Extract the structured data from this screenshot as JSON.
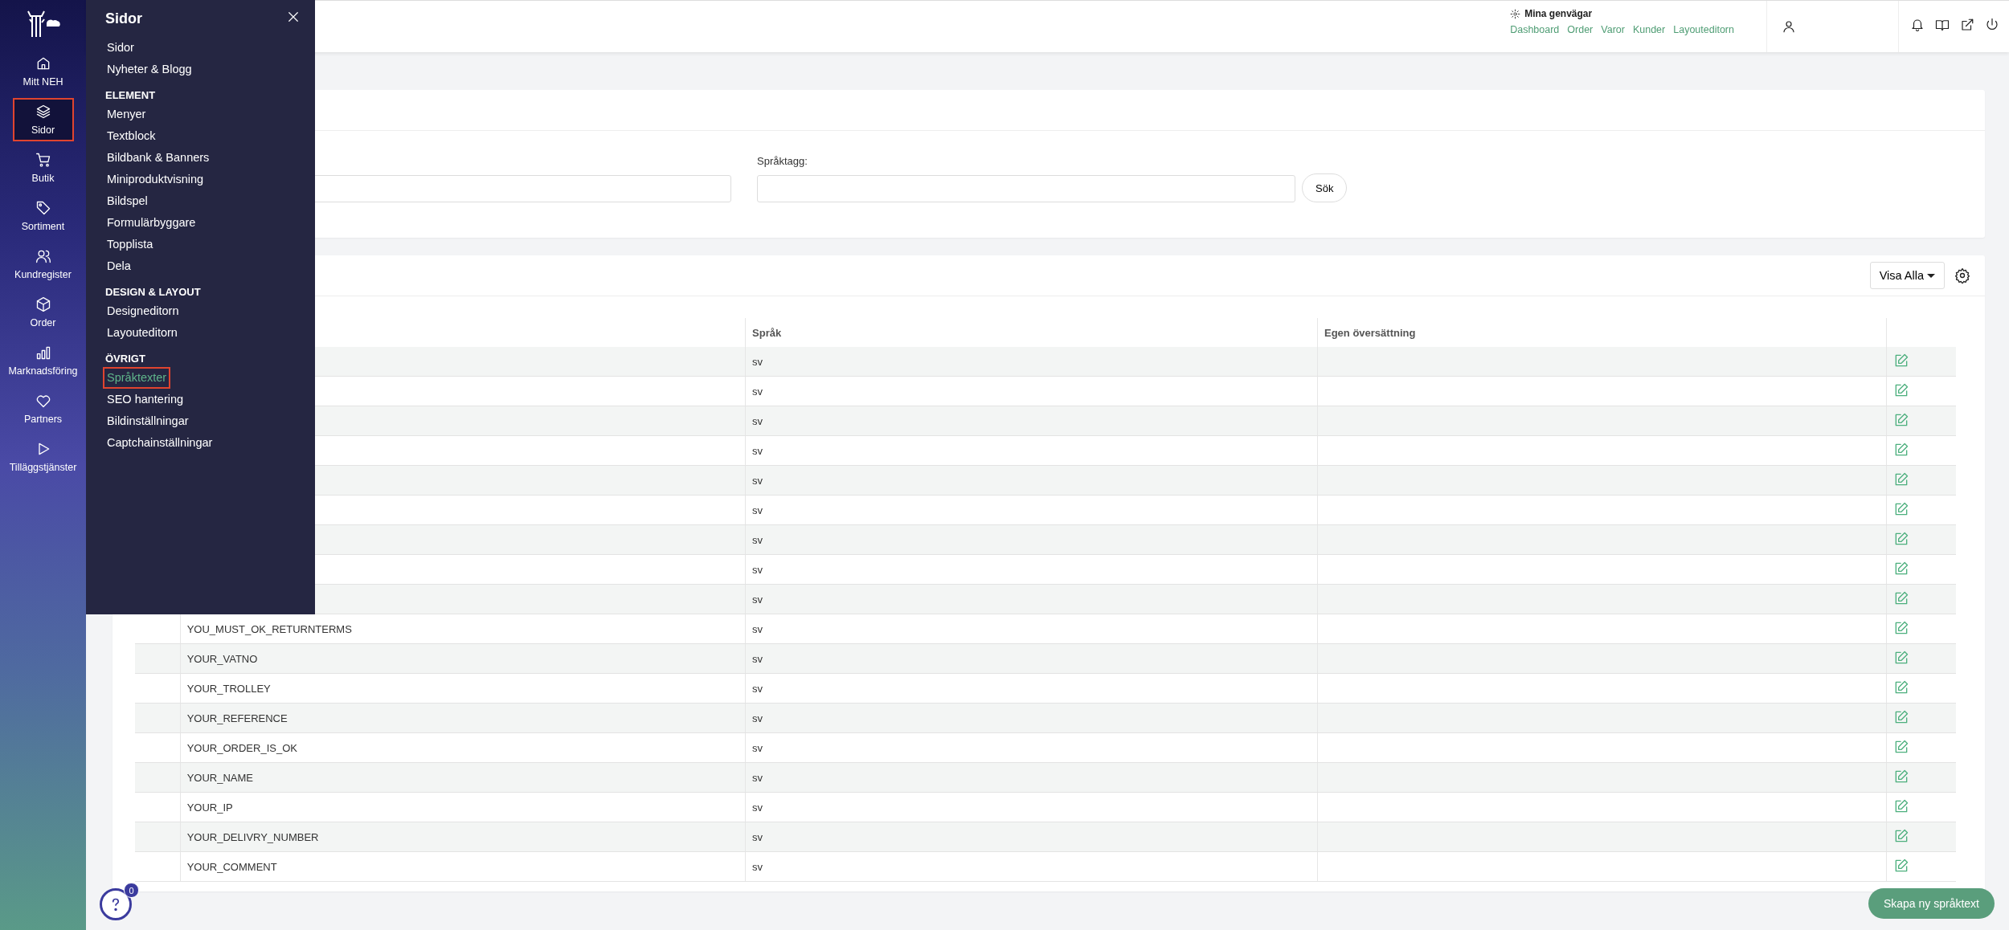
{
  "sidebar": {
    "items": [
      {
        "label": "Mitt NEH",
        "selected": false
      },
      {
        "label": "Sidor",
        "selected": true
      },
      {
        "label": "Butik",
        "selected": false
      },
      {
        "label": "Sortiment",
        "selected": false
      },
      {
        "label": "Kundregister",
        "selected": false
      },
      {
        "label": "Order",
        "selected": false
      },
      {
        "label": "Marknadsföring",
        "selected": false
      },
      {
        "label": "Partners",
        "selected": false
      },
      {
        "label": "Tilläggstjänster",
        "selected": false
      }
    ]
  },
  "flyout": {
    "title": "Sidor",
    "sections": [
      {
        "items": [
          {
            "label": "Sidor",
            "selected": false
          },
          {
            "label": "Nyheter & Blogg",
            "selected": false
          }
        ]
      },
      {
        "heading": "ELEMENT",
        "items": [
          {
            "label": "Menyer",
            "selected": false
          },
          {
            "label": "Textblock",
            "selected": false
          },
          {
            "label": "Bildbank & Banners",
            "selected": false
          },
          {
            "label": "Miniproduktvisning",
            "selected": false
          },
          {
            "label": "Bildspel",
            "selected": false
          },
          {
            "label": "Formulärbyggare",
            "selected": false
          },
          {
            "label": "Topplista",
            "selected": false
          },
          {
            "label": "Dela",
            "selected": false
          }
        ]
      },
      {
        "heading": "DESIGN & LAYOUT",
        "items": [
          {
            "label": "Designeditorn",
            "selected": false
          },
          {
            "label": "Layouteditorn",
            "selected": false
          }
        ]
      },
      {
        "heading": "ÖVRIGT",
        "items": [
          {
            "label": "Språktexter",
            "selected": true
          },
          {
            "label": "SEO hantering",
            "selected": false
          },
          {
            "label": "Bildinställningar",
            "selected": false
          },
          {
            "label": "Captchainställningar",
            "selected": false
          }
        ]
      }
    ]
  },
  "header": {
    "shortcuts": {
      "title": "Mina genvägar",
      "links": [
        "Dashboard",
        "Order",
        "Varor",
        "Kunder",
        "Layouteditorn"
      ]
    }
  },
  "search_card": {
    "fields": [
      {
        "kind": "unlabeled"
      },
      {
        "kind": "labeled",
        "label": "Språktagg:"
      }
    ],
    "button": "Sök"
  },
  "table_card": {
    "filter": "Visa Alla",
    "columns": [
      "Språk",
      "Egen översättning"
    ],
    "rows": [
      {
        "language": "sv"
      },
      {
        "language": "sv"
      },
      {
        "language": "sv"
      },
      {
        "language": "sv"
      },
      {
        "language": "sv"
      },
      {
        "language": "sv"
      },
      {
        "language": "sv"
      },
      {
        "language": "sv"
      },
      {
        "language": "sv"
      },
      {
        "tag": "YOU_MUST_OK_RETURNTERMS",
        "language": "sv"
      },
      {
        "tag": "YOUR_VATNO",
        "language": "sv"
      },
      {
        "tag": "YOUR_TROLLEY",
        "language": "sv"
      },
      {
        "tag": "YOUR_REFERENCE",
        "language": "sv"
      },
      {
        "tag": "YOUR_ORDER_IS_OK",
        "language": "sv"
      },
      {
        "tag": "YOUR_NAME",
        "language": "sv"
      },
      {
        "tag": "YOUR_IP",
        "language": "sv"
      },
      {
        "tag": "YOUR_DELIVRY_NUMBER",
        "language": "sv"
      },
      {
        "tag": "YOUR_COMMENT",
        "language": "sv"
      }
    ]
  },
  "create_button": "Skapa ny språktext",
  "help": {
    "badge": "0"
  }
}
